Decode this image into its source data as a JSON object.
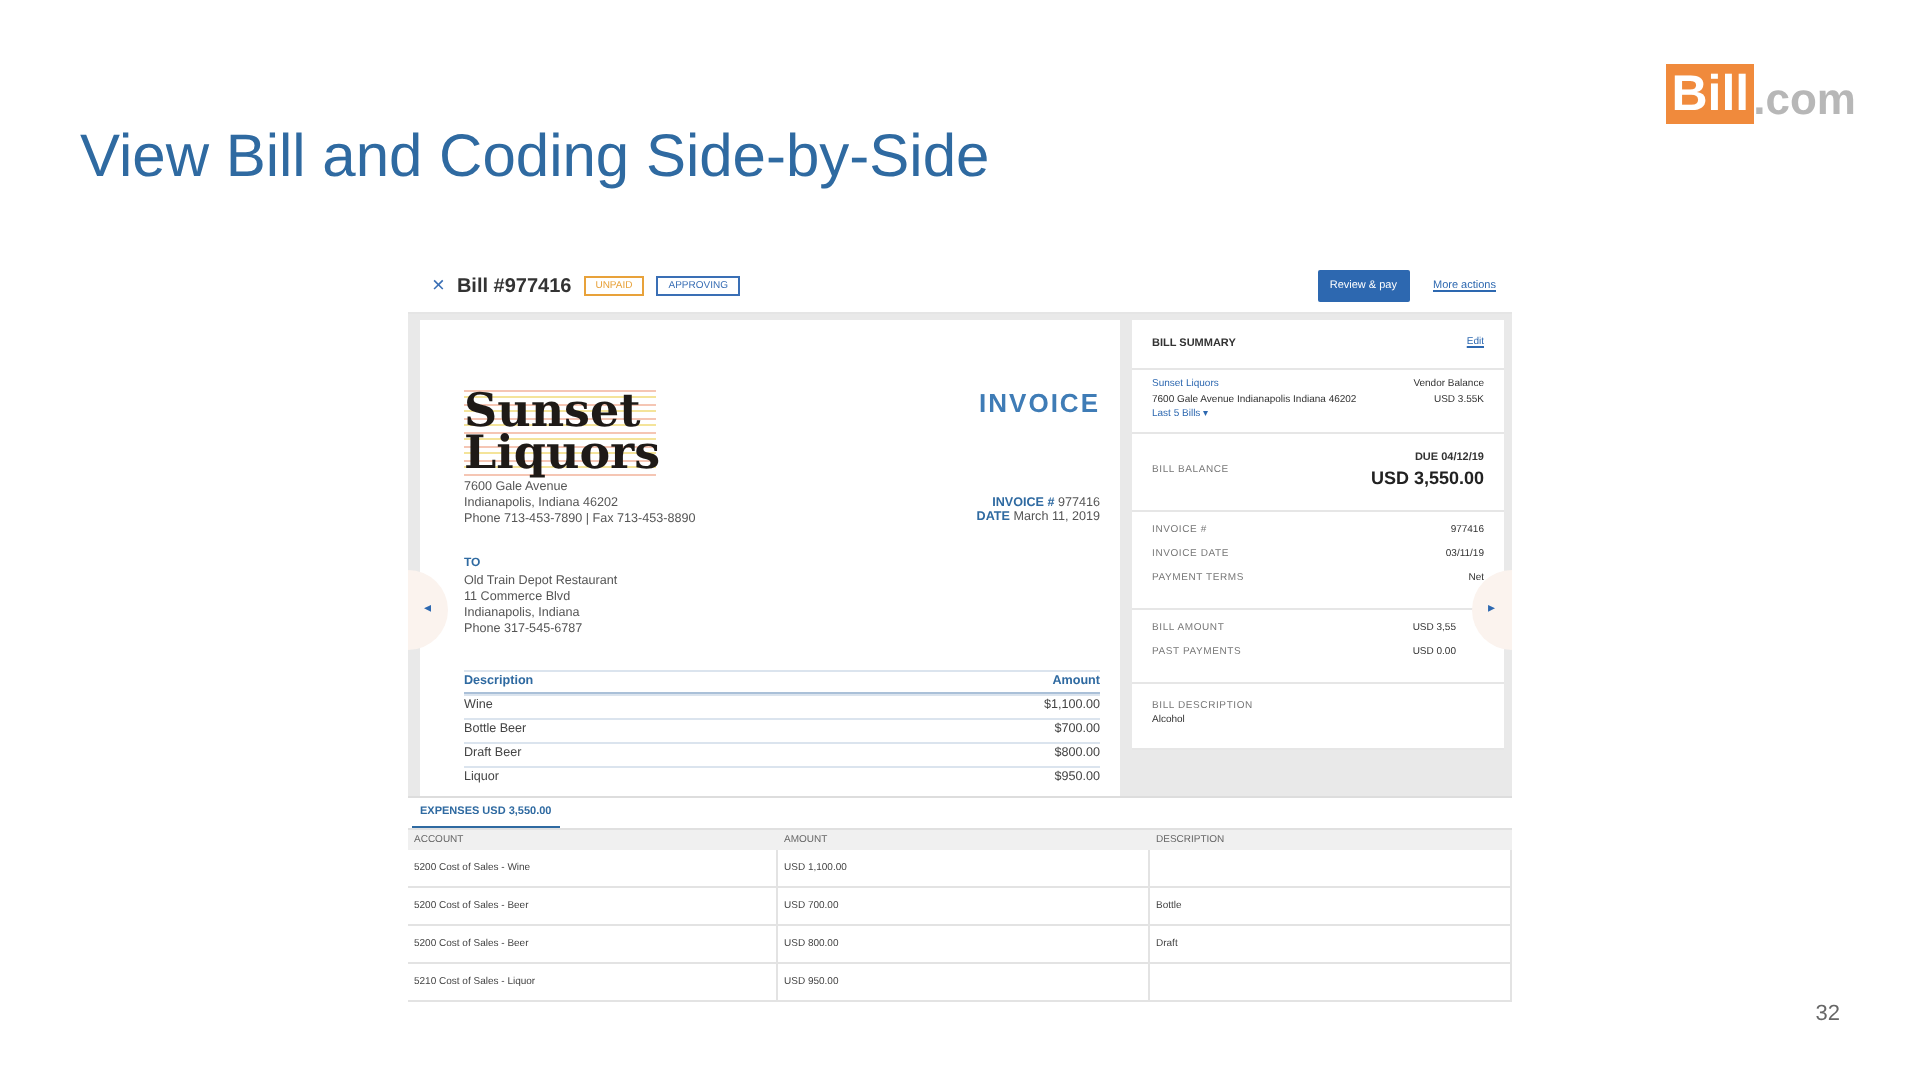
{
  "slide": {
    "title": "View Bill and Coding Side-by-Side",
    "page_number": "32"
  },
  "logo": {
    "highlight": "Bill",
    "suffix": ".com"
  },
  "bill_header": {
    "close": "×",
    "title": "Bill #977416",
    "badges": [
      {
        "label": "UNPAID",
        "color": "#e8a23a"
      },
      {
        "label": "APPROVING",
        "color": "#3a6fb5"
      }
    ],
    "primary_action": "Review & pay",
    "secondary_action": "More actions"
  },
  "nav_arrows": {
    "previous": "◂",
    "next": "▸"
  },
  "invoice": {
    "brand_line_1": "Sunset",
    "brand_line_2": "Liquors",
    "vendor_address": [
      "7600 Gale Avenue",
      "Indianapolis, Indiana 46202",
      "Phone 713-453-7890 | Fax 713-453-8890"
    ],
    "heading": "INVOICE",
    "number_label": "INVOICE #",
    "number": "977416",
    "date_label": "DATE",
    "date": "March 11, 2019",
    "to_label": "TO",
    "to_address": [
      "Old Train Depot Restaurant",
      "11 Commerce Blvd",
      "Indianapolis, Indiana",
      "Phone 317-545-6787"
    ],
    "columns": [
      "Description",
      "Amount"
    ],
    "rows": [
      [
        "Wine",
        "$1,100.00"
      ],
      [
        "Bottle Beer",
        "$700.00"
      ],
      [
        "Draft Beer",
        "$800.00"
      ],
      [
        "Liquor",
        "$950.00"
      ]
    ]
  },
  "summary": {
    "title": "BILL SUMMARY",
    "edit": "Edit",
    "vendor": "Sunset Liquors",
    "vendor_address": "7600 Gale Avenue Indianapolis Indiana 46202",
    "last_bills": "Last 5 Bills ▾",
    "vendor_balance_label": "Vendor Balance",
    "vendor_balance": "USD 3.55K",
    "balance_label": "BILL BALANCE",
    "due": "DUE 04/12/19",
    "balance": "USD 3,550.00",
    "details": [
      {
        "label": "INVOICE #",
        "value": "977416"
      },
      {
        "label": "INVOICE DATE",
        "value": "03/11/19"
      },
      {
        "label": "PAYMENT TERMS",
        "value": "Net"
      }
    ],
    "amounts": [
      {
        "label": "BILL AMOUNT",
        "value": "USD 3,55"
      },
      {
        "label": "PAST PAYMENTS",
        "value": "USD 0.00"
      }
    ],
    "description_label": "BILL DESCRIPTION",
    "description": "Alcohol"
  },
  "expenses": {
    "tab": "EXPENSES USD 3,550.00",
    "columns": [
      "ACCOUNT",
      "AMOUNT",
      "DESCRIPTION"
    ],
    "rows": [
      {
        "account": "5200 Cost of Sales - Wine",
        "amount": "USD 1,100.00"
      },
      {
        "account": "5200 Cost of Sales - Beer",
        "amount": "USD 700.00",
        "description": "Bottle"
      },
      {
        "account": "5200 Cost of Sales - Beer",
        "amount": "USD 800.00",
        "description": "Draft"
      },
      {
        "account": "5210 Cost of Sales - Liquor",
        "amount": "USD 950.00"
      }
    ]
  }
}
